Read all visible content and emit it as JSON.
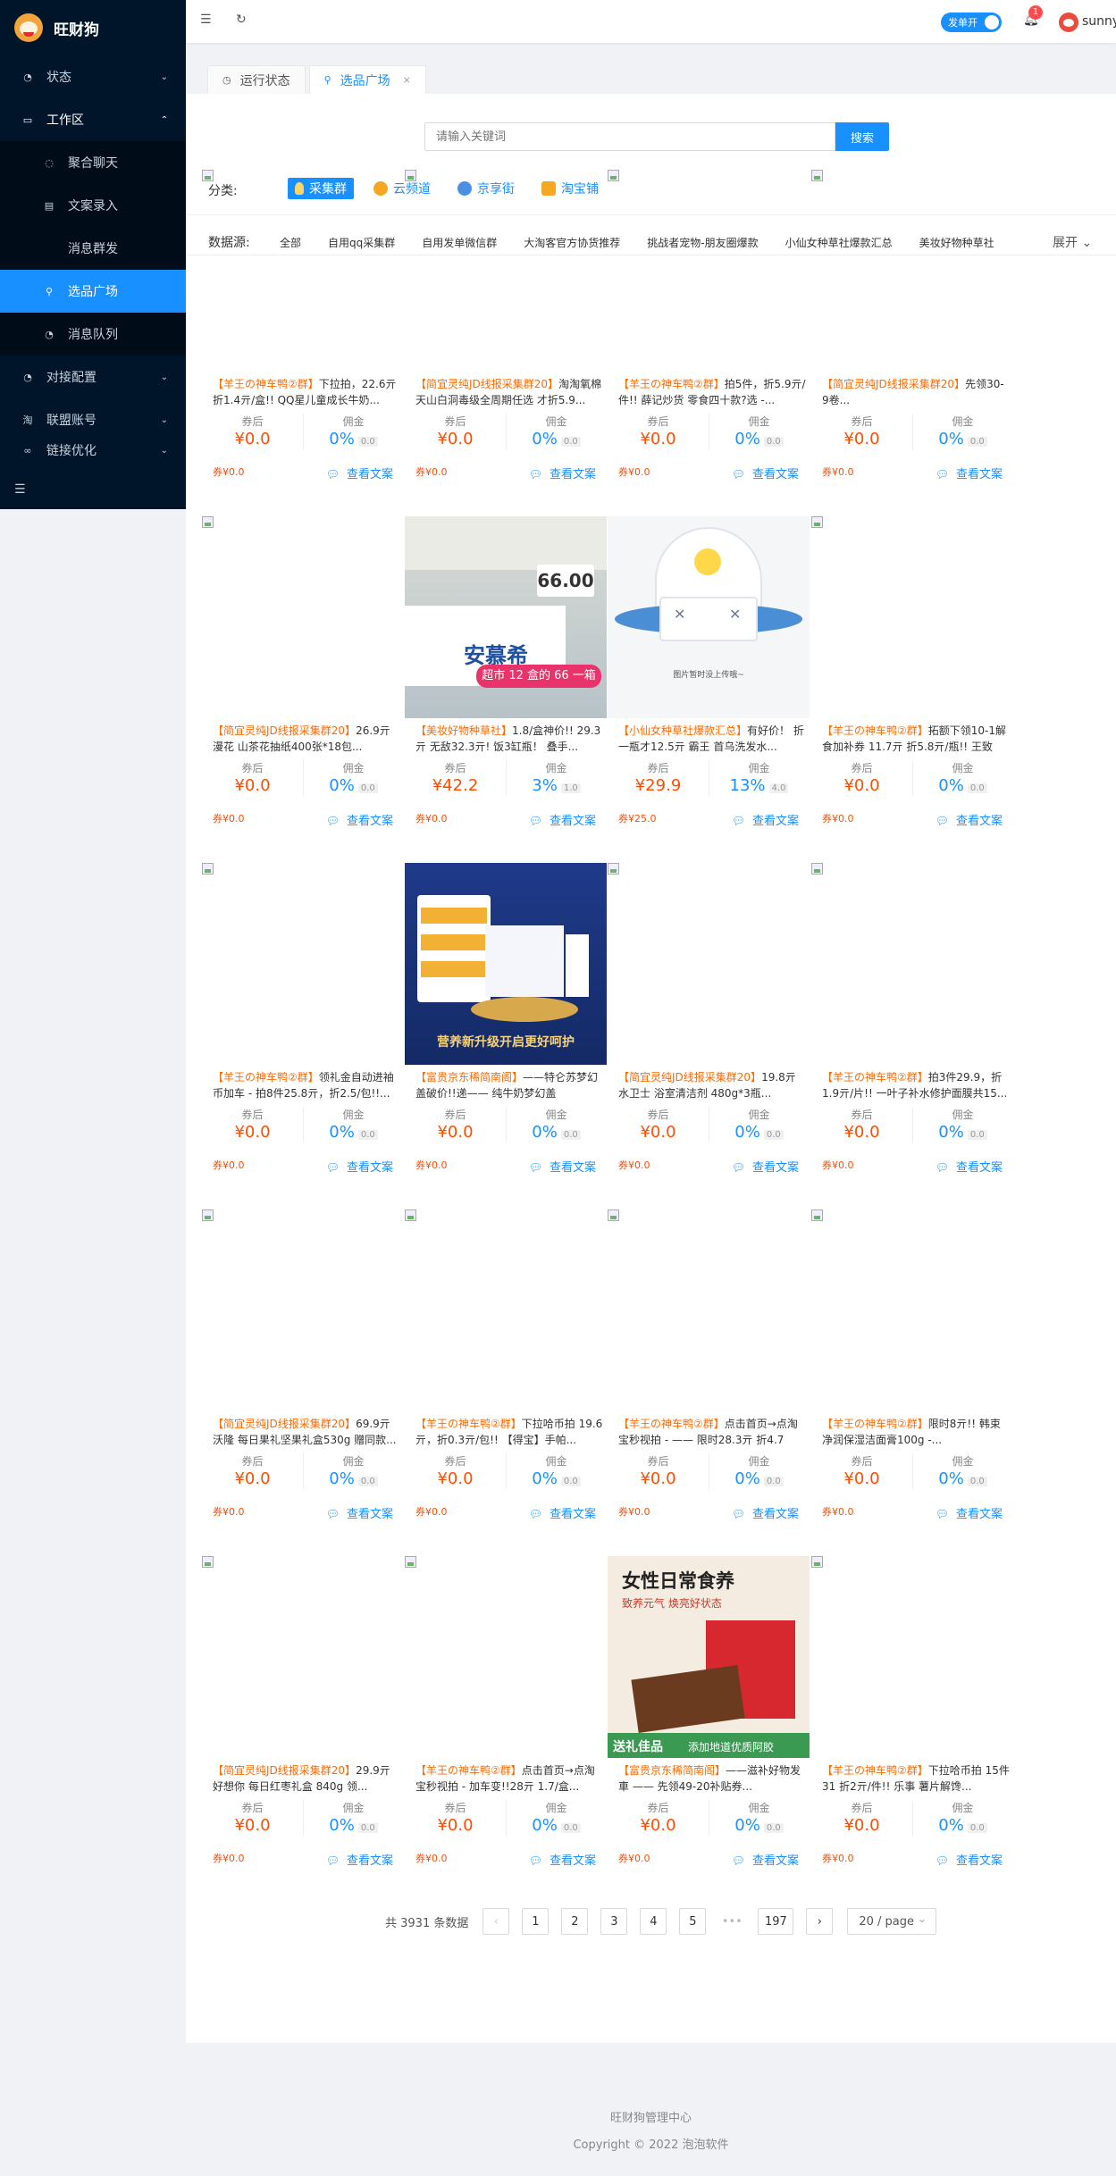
{
  "app": {
    "name": "旺财狗"
  },
  "sidebar": {
    "items": [
      {
        "label": "状态",
        "icon": "dashboard-icon"
      },
      {
        "label": "工作区",
        "icon": "desktop-icon"
      },
      {
        "label": "聚合聊天",
        "icon": "chat-icon"
      },
      {
        "label": "文案录入",
        "icon": "file-icon"
      },
      {
        "label": "消息群发",
        "icon": "broadcast-icon"
      },
      {
        "label": "选品广场",
        "icon": "shop-icon"
      },
      {
        "label": "消息队列",
        "icon": "queue-icon"
      },
      {
        "label": "对接配置",
        "icon": "settings-icon"
      },
      {
        "label": "联盟账号",
        "icon": "taobao-icon"
      },
      {
        "label": "链接优化",
        "icon": "link-icon"
      }
    ]
  },
  "header": {
    "toggle_label": "发单开",
    "badge_count": "1",
    "username": "sunny"
  },
  "tabs": [
    {
      "label": "运行状态"
    },
    {
      "label": "选品广场"
    }
  ],
  "search": {
    "placeholder": "请输入关键词",
    "button": "搜索"
  },
  "categories": {
    "label": "分类:",
    "items": [
      {
        "label": "采集群",
        "color": "#1890ff"
      },
      {
        "label": "云频道",
        "color": "#f5a623"
      },
      {
        "label": "京享街",
        "color": "#4a90e2"
      },
      {
        "label": "淘宝铺",
        "color": "#f5a623"
      }
    ]
  },
  "sources": {
    "label": "数据源:",
    "items": [
      "全部",
      "自用qq采集群",
      "自用发单微信群",
      "大淘客官方协货推荐",
      "挑战者宠物-朋友圈爆款",
      "小仙女种草社爆款汇总",
      "美妆好物种草社"
    ],
    "expand": "展开"
  },
  "card_labels": {
    "coupon_after": "券后",
    "commission": "佣金",
    "view_copy": "查看文案"
  },
  "products": [
    {
      "group": "【羊王の神车鸭②群】",
      "text": "下拉拍，22.6亓折1.4亓/盒!! QQ星儿童成长牛奶...",
      "price": "¥0.0",
      "rate": "0%",
      "comm": "0.0",
      "coupon": "券¥0.0"
    },
    {
      "group": "【简宜灵纯JD线报采集群20】",
      "text": "淘淘氧棉 天山白洞毒级全周期任选 才折5.9...",
      "price": "¥0.0",
      "rate": "0%",
      "comm": "0.0",
      "coupon": "券¥0.0"
    },
    {
      "group": "【羊王の神车鸭②群】",
      "text": "拍5件，折5.9亓/件!! 薛记炒货 零食四十款?选 -...",
      "price": "¥0.0",
      "rate": "0%",
      "comm": "0.0",
      "coupon": "券¥0.0"
    },
    {
      "group": "【简宜灵纯JD线报采集群20】",
      "text": "先领30-9卷...",
      "price": "¥0.0",
      "rate": "0%",
      "comm": "0.0",
      "coupon": "券¥0.0"
    },
    {
      "group": "【简宜灵纯JD线报采集群20】",
      "text": "26.9亓 漫花 山茶花抽纸400张*18包...",
      "price": "¥0.0",
      "rate": "0%",
      "comm": "0.0",
      "coupon": "券¥0.0"
    },
    {
      "group": "【美妆好物种草社】",
      "text": "1.8/盒神价!! 29.3亓 无敌32.3亓! 饭3缸瓶！ 叠手...",
      "price": "¥42.2",
      "rate": "3%",
      "comm": "1.0",
      "coupon": "券¥0.0"
    },
    {
      "group": "【小仙女种草社爆款汇总】",
      "text": "有好价！ 折一瓶才12.5亓 霸王 首乌洗发水...",
      "price": "¥29.9",
      "rate": "13%",
      "comm": "4.0",
      "coupon": "券¥25.0"
    },
    {
      "group": "【羊王の神车鸭②群】",
      "text": "拓额下领10-1解食加补券 11.7亓 折5.8亓/瓶!! 王致和...",
      "price": "¥0.0",
      "rate": "0%",
      "comm": "0.0",
      "coupon": "券¥0.0"
    },
    {
      "group": "【羊王の神车鸭②群】",
      "text": "领礼金自动进袖币加车 - 拍8件25.8亓，折2.5/包!!...",
      "price": "¥0.0",
      "rate": "0%",
      "comm": "0.0",
      "coupon": "券¥0.0"
    },
    {
      "group": "【富贵京东稀简南阁】",
      "text": "——特仑苏梦幻盖破价!!递—— 纯牛奶梦幻盖250ml*...",
      "price": "¥0.0",
      "rate": "0%",
      "comm": "0.0",
      "coupon": "券¥0.0"
    },
    {
      "group": "【简宜灵纯JD线报采集群20】",
      "text": "19.8亓 水卫士 浴室清洁剂 480g*3瓶...",
      "price": "¥0.0",
      "rate": "0%",
      "comm": "0.0",
      "coupon": "券¥0.0"
    },
    {
      "group": "【羊王の神车鸭②群】",
      "text": "拍3件29.9，折1.9亓/片!! 一叶子补水修护面膜共15...",
      "price": "¥0.0",
      "rate": "0%",
      "comm": "0.0",
      "coupon": "券¥0.0"
    },
    {
      "group": "【简宜灵纯JD线报采集群20】",
      "text": "69.9亓 沃隆 每日果礼坚果礼盒530g 赠同款...",
      "price": "¥0.0",
      "rate": "0%",
      "comm": "0.0",
      "coupon": "券¥0.0"
    },
    {
      "group": "【羊王の神车鸭②群】",
      "text": "下拉哈币拍 19.6亓，折0.3亓/包!! 【得宝】手帕...",
      "price": "¥0.0",
      "rate": "0%",
      "comm": "0.0",
      "coupon": "券¥0.0"
    },
    {
      "group": "【羊王の神车鸭②群】",
      "text": "点击首页→点淘宝秒视拍 - —— 限时28.3亓 折4.7亓/...",
      "price": "¥0.0",
      "rate": "0%",
      "comm": "0.0",
      "coupon": "券¥0.0"
    },
    {
      "group": "【羊王の神车鸭②群】",
      "text": "限时8亓!! 韩束 净润保湿洁面膏100g -...",
      "price": "¥0.0",
      "rate": "0%",
      "comm": "0.0",
      "coupon": "券¥0.0"
    },
    {
      "group": "【简宜灵纯JD线报采集群20】",
      "text": "29.9亓 好想你 每日红枣礼盒 840g 领...",
      "price": "¥0.0",
      "rate": "0%",
      "comm": "0.0",
      "coupon": "券¥0.0"
    },
    {
      "group": "【羊王の神车鸭②群】",
      "text": "点击首页→点淘宝秒视拍 - 加车变!!28亓 1.7/盒...",
      "price": "¥0.0",
      "rate": "0%",
      "comm": "0.0",
      "coupon": "券¥0.0"
    },
    {
      "group": "【富贵京东稀简南阁】",
      "text": "——滋补好物发車 —— 先领49-20补贴券...",
      "price": "¥0.0",
      "rate": "0%",
      "comm": "0.0",
      "coupon": "券¥0.0"
    },
    {
      "group": "【羊王の神车鸭②群】",
      "text": "下拉哈币拍 15件31 折2亓/件!! 乐事 薯片解馋...",
      "price": "¥0.0",
      "rate": "0%",
      "comm": "0.0",
      "coupon": "券¥0.0"
    }
  ],
  "image_texts": {
    "p6_price": "66.00",
    "p6_brand": "安慕希",
    "p6_banner": "超市 12 盒的 66 一箱",
    "p7_placeholder": "图片暂时没上传哦~",
    "p10_banner": "营养新升级开启更好呵护",
    "p19_title": "女性日常食养",
    "p19_sub": "致养元气 焕亮好状态",
    "p19_banner": "送礼佳品",
    "p19_banner2": "添加地道优质阿胶"
  },
  "pagination": {
    "total": "共 3931 条数据",
    "pages": [
      "1",
      "2",
      "3",
      "4",
      "5",
      "•••",
      "197"
    ],
    "page_size": "20 / page"
  },
  "footer": {
    "line1": "旺财狗管理中心",
    "line2": "Copyright © 2022 泡泡软件"
  }
}
